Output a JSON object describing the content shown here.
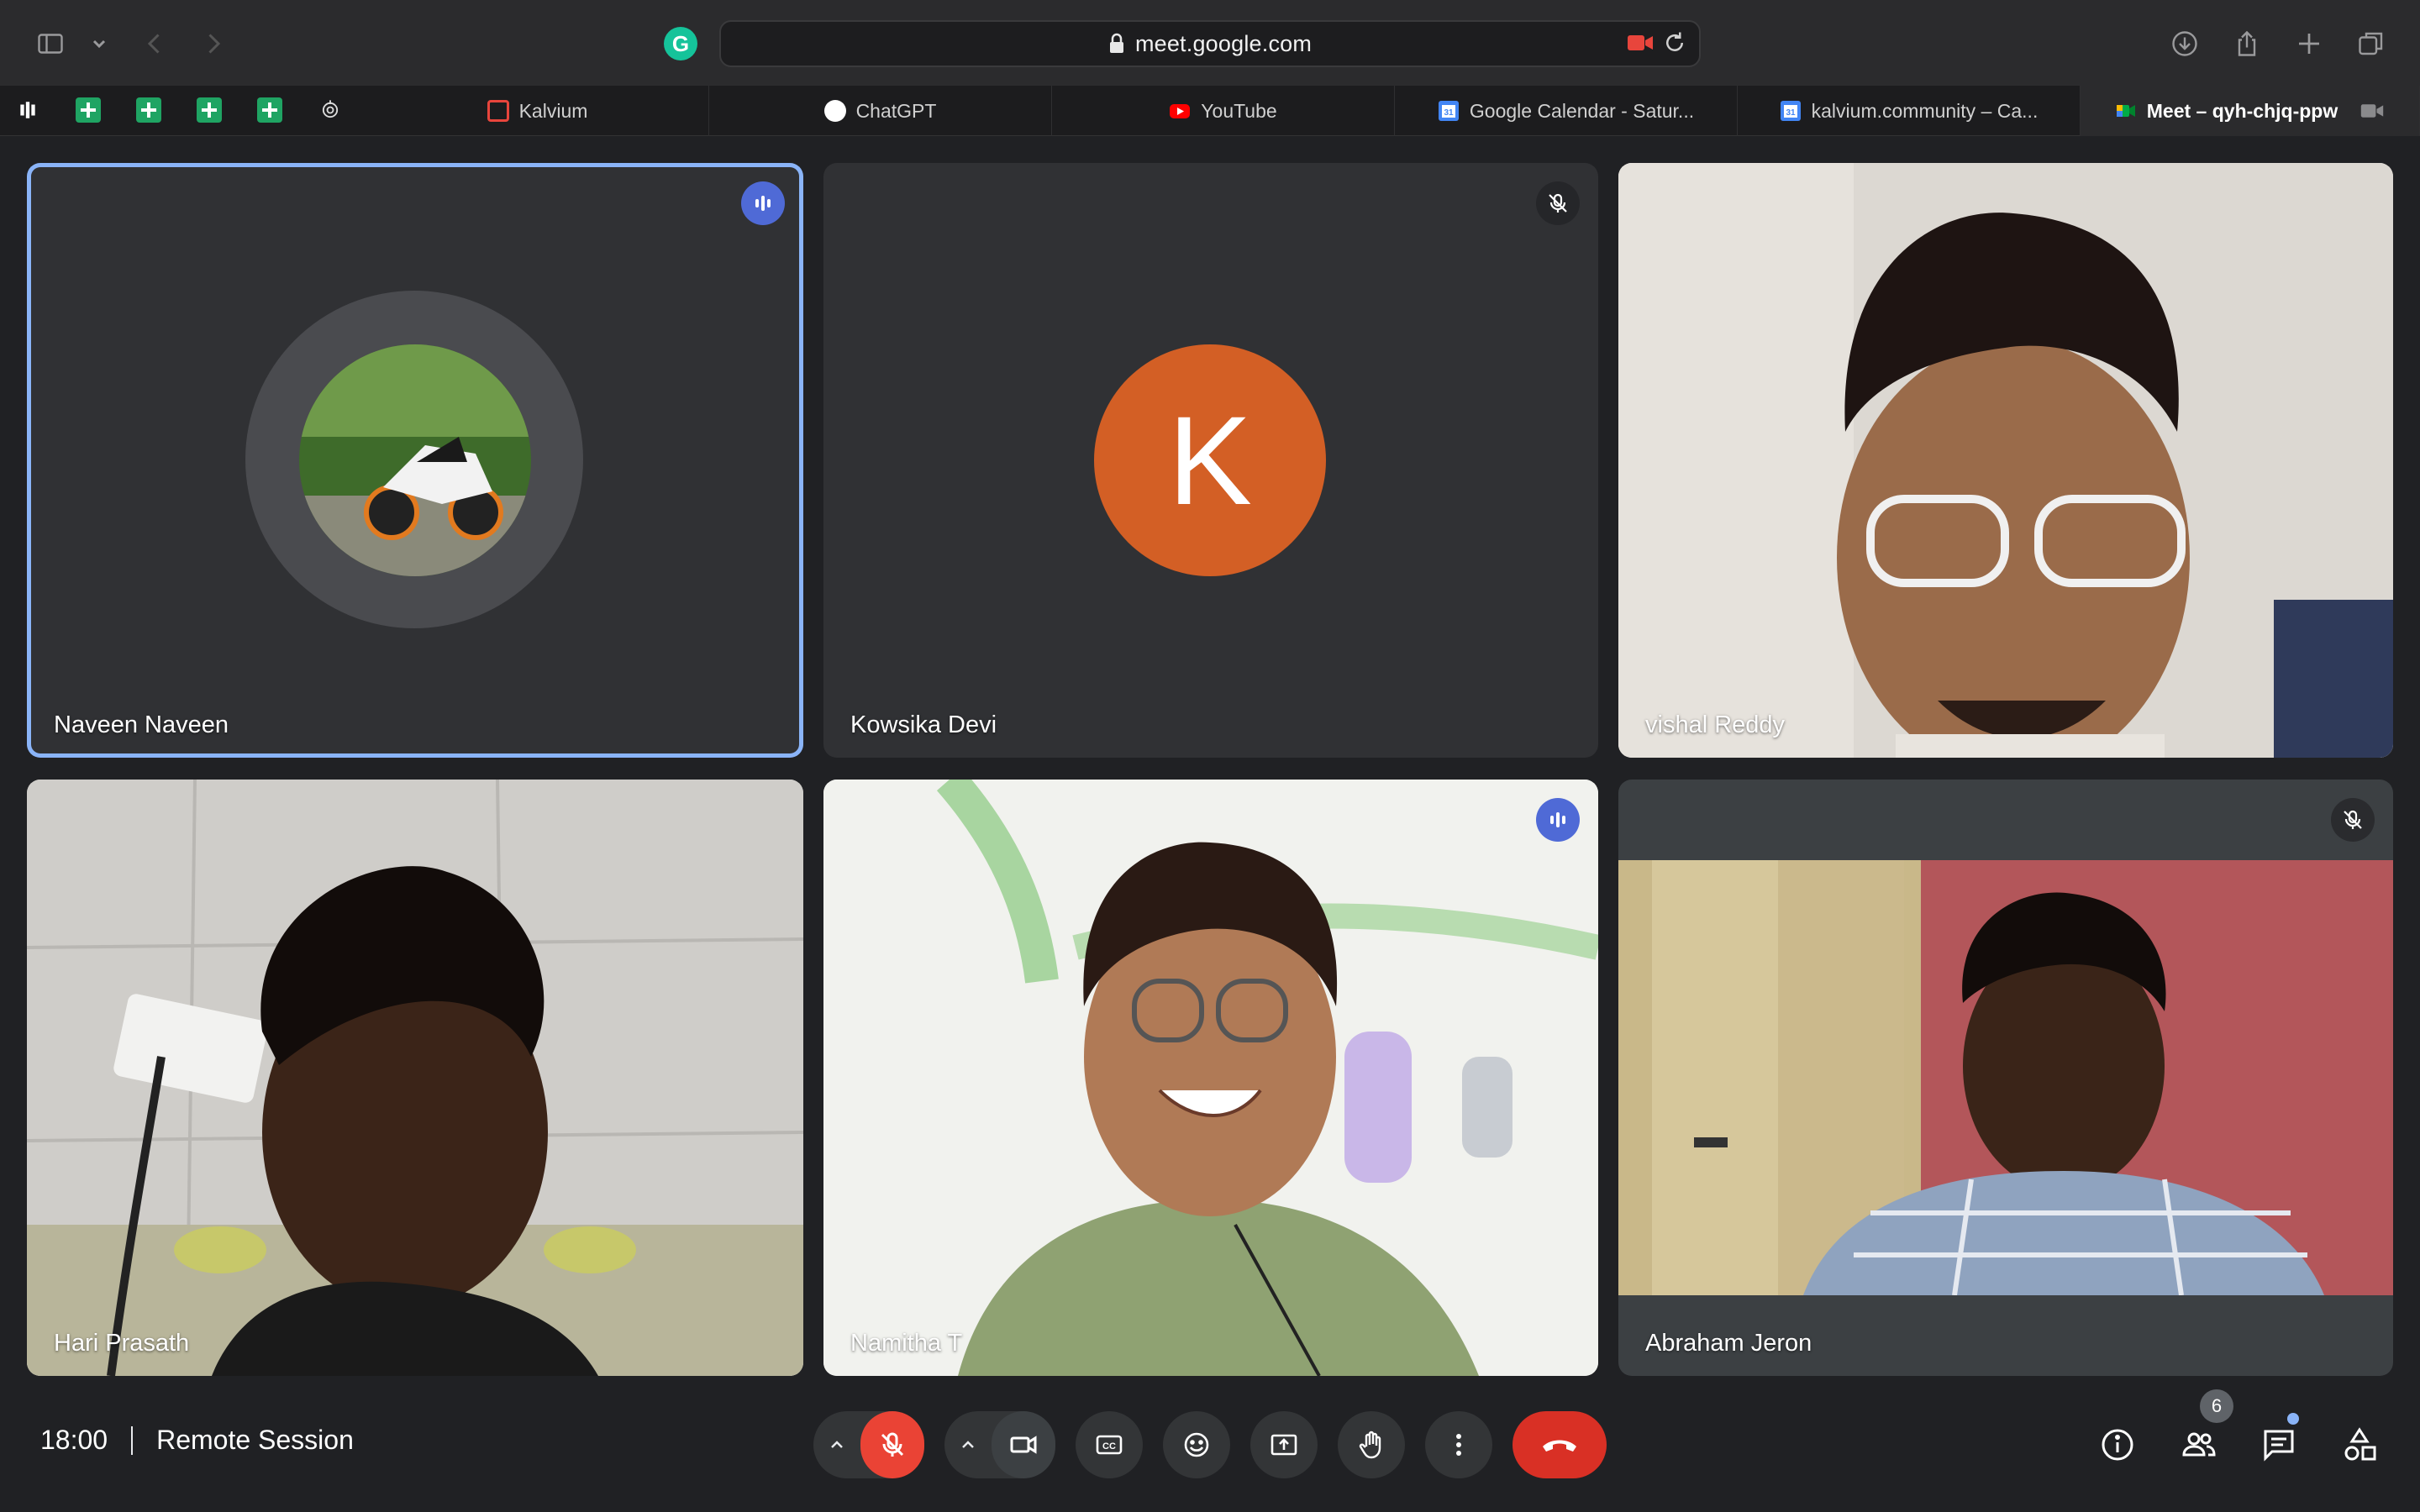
{
  "browser": {
    "url": "meet.google.com",
    "tabs": [
      {
        "label": "Kalvium",
        "favicon_color": "#e8453c"
      },
      {
        "label": "ChatGPT",
        "favicon_color": "#ffffff"
      },
      {
        "label": "YouTube",
        "favicon_color": "#ff0000"
      },
      {
        "label": "Google Calendar - Satur...",
        "favicon_color": "#4285f4"
      },
      {
        "label": "kalvium.community – Ca...",
        "favicon_color": "#4285f4"
      },
      {
        "label": "Meet – qyh-chjq-ppw",
        "favicon_color": "#00ac47",
        "active": true
      }
    ],
    "pinned_tabs": [
      "sheets-icon",
      "sheets-icon",
      "sheets-icon",
      "sheets-icon",
      "ai-icon"
    ]
  },
  "participants": [
    {
      "name": "Naveen Naveen",
      "status": "speaking",
      "display": "avatar-photo"
    },
    {
      "name": "Kowsika Devi",
      "status": "muted",
      "display": "letter",
      "initial": "K",
      "avatar_color": "#d35f25"
    },
    {
      "name": "vishal Reddy",
      "status": "none",
      "display": "video"
    },
    {
      "name": "Hari Prasath",
      "status": "none",
      "display": "video"
    },
    {
      "name": "Namitha T",
      "status": "speaking",
      "display": "video"
    },
    {
      "name": "Abraham Jeron",
      "status": "muted",
      "display": "video"
    }
  ],
  "meeting": {
    "time": "18:00",
    "title": "Remote Session",
    "people_count": "6"
  },
  "colors": {
    "accent_speaking": "#8ab4f8",
    "hangup": "#d93025",
    "mic_off": "#ea4335"
  }
}
